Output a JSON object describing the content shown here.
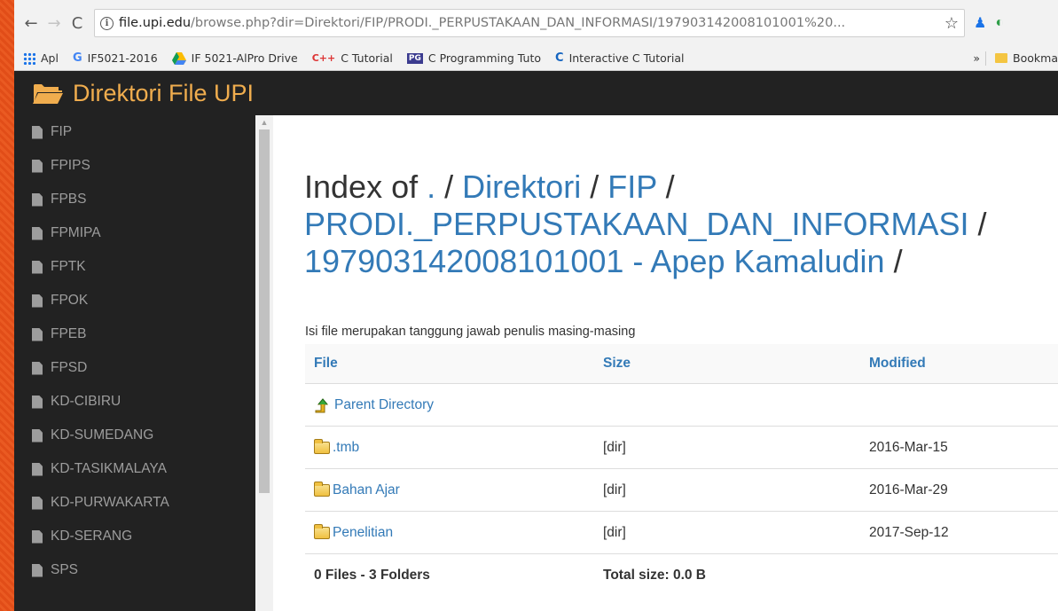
{
  "browser": {
    "url_host": "file.upi.edu",
    "url_path": "/browse.php?dir=Direktori/FIP/PRODI._PERPUSTAKAAN_DAN_INFORMASI/197903142008101001%20...",
    "bookmarks": [
      {
        "label": "Apl",
        "icon": "apps-grid-icon"
      },
      {
        "label": "IF5021-2016",
        "icon": "google-icon"
      },
      {
        "label": "IF 5021-AlPro Drive",
        "icon": "drive-icon"
      },
      {
        "label": "C Tutorial",
        "icon": "cpp-icon"
      },
      {
        "label": "C Programming Tuto",
        "icon": "site-icon"
      },
      {
        "label": "Interactive C Tutorial",
        "icon": "c-icon"
      }
    ],
    "overflow_label": "»",
    "bookmarks_folder": "Bookma"
  },
  "site": {
    "title": "Direktori File UPI",
    "accent_color": "#f0ad4e"
  },
  "sidebar": {
    "items": [
      "FIP",
      "FPIPS",
      "FPBS",
      "FPMIPA",
      "FPTK",
      "FPOK",
      "FPEB",
      "FPSD",
      "KD-CIBIRU",
      "KD-SUMEDANG",
      "KD-TASIKMALAYA",
      "KD-PURWAKARTA",
      "KD-SERANG",
      "SPS"
    ]
  },
  "main": {
    "title_prefix": "Index of",
    "breadcrumb": [
      {
        "label": ".",
        "sep": "/"
      },
      {
        "label": "Direktori",
        "sep": "/"
      },
      {
        "label": "FIP",
        "sep": "/"
      },
      {
        "label": "PRODI._PERPUSTAKAAN_DAN_INFORMASI",
        "sep": "/"
      },
      {
        "label": "197903142008101001 - Apep Kamaludin",
        "sep": "/"
      }
    ],
    "notice": "Isi file merupakan tanggung jawab penulis masing-masing",
    "table": {
      "headers": {
        "file": "File",
        "size": "Size",
        "modified": "Modified"
      },
      "parent": "Parent Directory",
      "rows": [
        {
          "name": ".tmb",
          "size": "[dir]",
          "modified": "2016-Mar-15"
        },
        {
          "name": "Bahan Ajar",
          "size": "[dir]",
          "modified": "2016-Mar-29"
        },
        {
          "name": "Penelitian",
          "size": "[dir]",
          "modified": "2017-Sep-12"
        }
      ],
      "footer": {
        "count": "0 Files - 3 Folders",
        "total": "Total size: 0.0  B"
      }
    }
  }
}
